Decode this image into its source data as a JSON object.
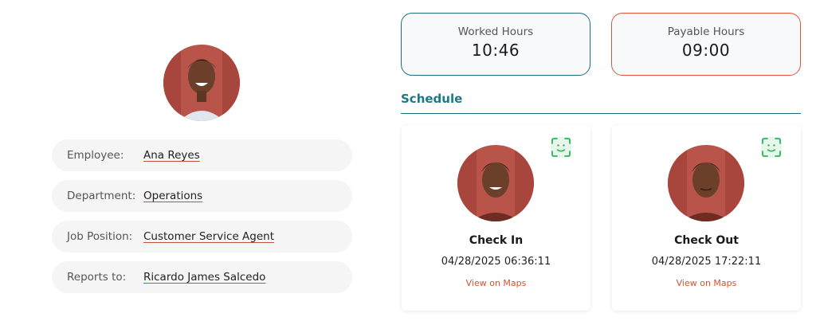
{
  "profile": {
    "avatar_alt": "employee photo",
    "fields": [
      {
        "label": "Employee:",
        "value": "Ana Reyes"
      },
      {
        "label": "Department:",
        "value": "Operations"
      },
      {
        "label": "Job Position:",
        "value": "Customer Service Agent"
      },
      {
        "label": "Reports to:",
        "value": "Ricardo James Salcedo"
      }
    ]
  },
  "stats": {
    "worked": {
      "title": "Worked Hours",
      "value": "10:46",
      "border_color": "#1c6e7a"
    },
    "payable": {
      "title": "Payable Hours",
      "value": "09:00",
      "border_color": "#e0553a"
    }
  },
  "schedule": {
    "title": "Schedule",
    "check_in": {
      "title": "Check In",
      "timestamp": "04/28/2025 06:36:11",
      "link": "View on Maps",
      "icon": "face-scan-icon"
    },
    "check_out": {
      "title": "Check Out",
      "timestamp": "04/28/2025 17:22:11",
      "link": "View on Maps",
      "icon": "face-scan-icon"
    }
  },
  "colors": {
    "accent": "#1c7a84",
    "link": "#d4532e",
    "face_icon": "#2fb35a"
  }
}
